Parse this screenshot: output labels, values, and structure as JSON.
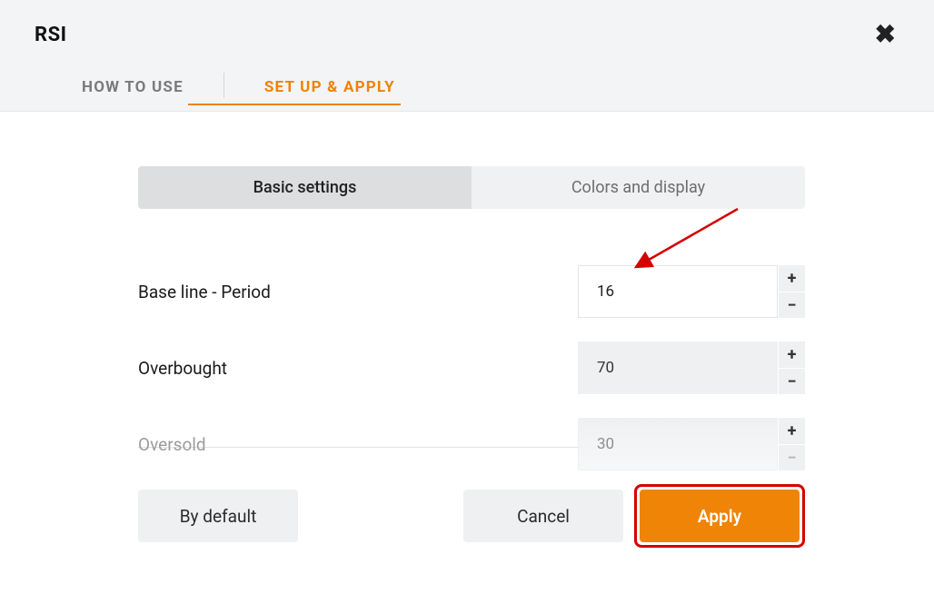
{
  "dialog": {
    "title": "RSI"
  },
  "tabs": {
    "how_to_use": "HOW TO USE",
    "set_up_apply": "SET UP & APPLY"
  },
  "subtabs": {
    "basic": "Basic settings",
    "colors": "Colors and display"
  },
  "fields": {
    "period": {
      "label": "Base line - Period",
      "value": "16"
    },
    "overbought": {
      "label": "Overbought",
      "value": "70"
    },
    "oversold": {
      "label": "Oversold",
      "value": "30"
    }
  },
  "buttons": {
    "default": "By default",
    "cancel": "Cancel",
    "apply": "Apply"
  },
  "colors": {
    "accent": "#ee8208",
    "highlight": "#d40000"
  }
}
